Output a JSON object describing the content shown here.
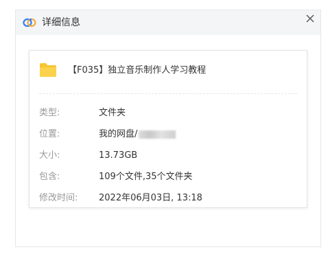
{
  "window": {
    "title": "详细信息",
    "app_icon": "baidu-netdisk-icon",
    "close_icon": "close-icon",
    "accent_color": "#3b8cf7"
  },
  "file": {
    "icon": "folder-icon",
    "folder_color": "#f7c531",
    "name": "【F035】独立音乐制作人学习教程"
  },
  "details": {
    "type_label": "类型:",
    "type_value": "文件夹",
    "location_label": "位置:",
    "location_value": "我的网盘/",
    "size_label": "大小:",
    "size_value": "13.73GB",
    "contains_label": "包含:",
    "contains_value": "109个文件,35个文件夹",
    "modified_label": "修改时间:",
    "modified_value": "2022年06月03日, 13:18"
  }
}
